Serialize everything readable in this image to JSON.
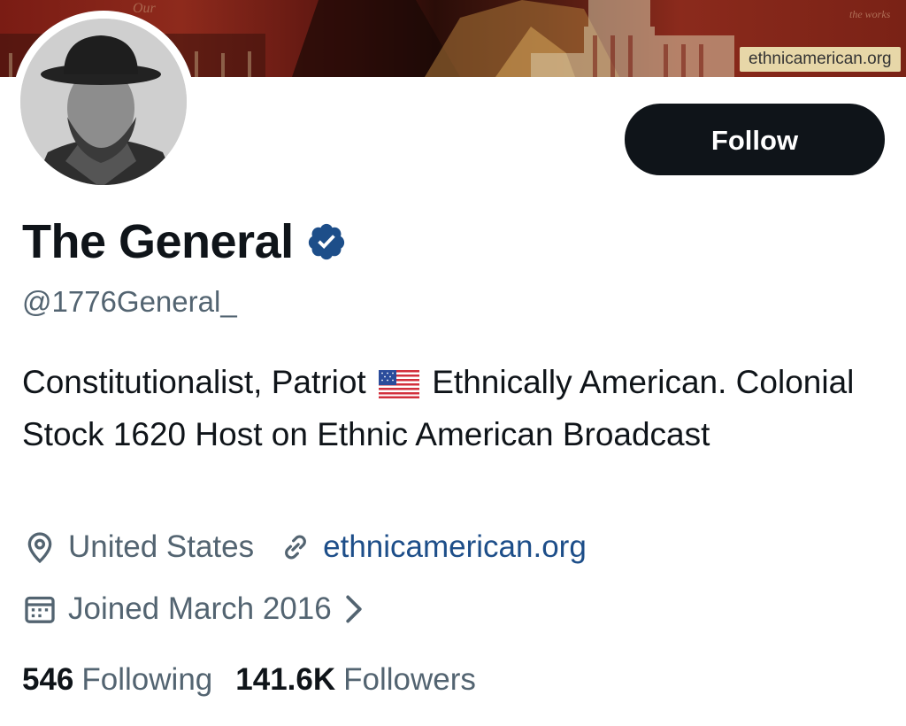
{
  "banner": {
    "site_label": "ethnicamerican.org"
  },
  "profile": {
    "name": "The General",
    "handle": "@1776General_",
    "bio_part1": "Constitutionalist, Patriot",
    "bio_part2": "Ethnically American. Colonial Stock 1620 Host on Ethnic American Broadcast",
    "location": "United States",
    "website": "ethnicamerican.org",
    "joined": "Joined March 2016"
  },
  "actions": {
    "follow_label": "Follow"
  },
  "stats": {
    "following_count": "546",
    "following_label": "Following",
    "followers_count": "141.6K",
    "followers_label": "Followers"
  },
  "colors": {
    "verified": "#1d4e89",
    "button": "#0f1419",
    "secondary_text": "#536471",
    "link": "#1d4e89"
  },
  "icons": [
    "verified-badge-icon",
    "flag-us-icon",
    "location-pin-icon",
    "link-icon",
    "calendar-icon",
    "chevron-right-icon"
  ]
}
